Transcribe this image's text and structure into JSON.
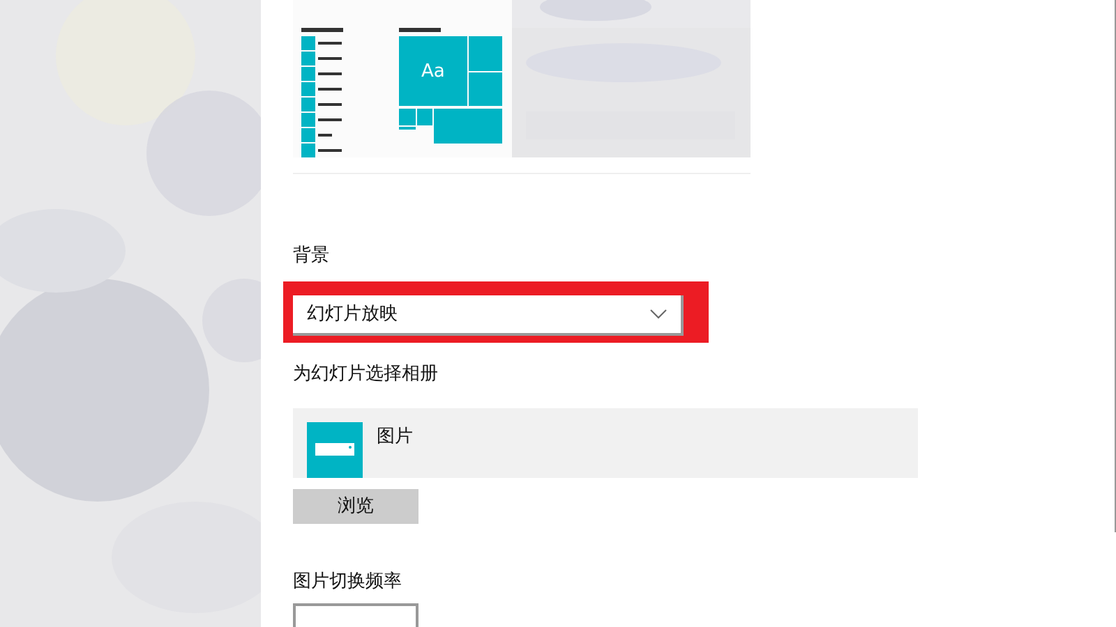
{
  "preview": {
    "tile_label": "Aa"
  },
  "background": {
    "label": "背景",
    "value": "幻灯片放映",
    "highlighted": true
  },
  "album": {
    "label": "为幻灯片选择相册",
    "name": "图片"
  },
  "browse_button": "浏览",
  "interval": {
    "label": "图片切换频率"
  }
}
